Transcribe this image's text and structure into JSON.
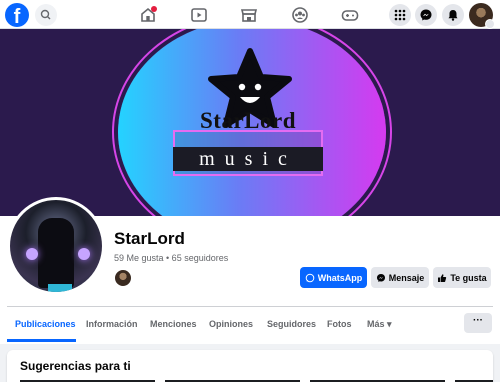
{
  "topbar": {
    "logo_letter": "f",
    "nav_items": [
      "home",
      "video",
      "marketplace",
      "groups",
      "gaming"
    ]
  },
  "cover": {
    "brand_name": "StarLord",
    "brand_sub": "music"
  },
  "profile": {
    "name": "StarLord",
    "stats": "59 Me gusta • 65 seguidores"
  },
  "actions": {
    "whatsapp": "WhatsApp",
    "message": "Mensaje",
    "like": "Te gusta"
  },
  "tabs": [
    {
      "label": "Publicaciones"
    },
    {
      "label": "Información"
    },
    {
      "label": "Menciones"
    },
    {
      "label": "Opiniones"
    },
    {
      "label": "Seguidores"
    },
    {
      "label": "Fotos"
    },
    {
      "label": "Más ▾"
    }
  ],
  "more_label": "···",
  "suggestions": {
    "title": "Sugerencias para ti"
  },
  "colors": {
    "accent": "#0866ff",
    "cover_bg": "#2b1a4d"
  }
}
